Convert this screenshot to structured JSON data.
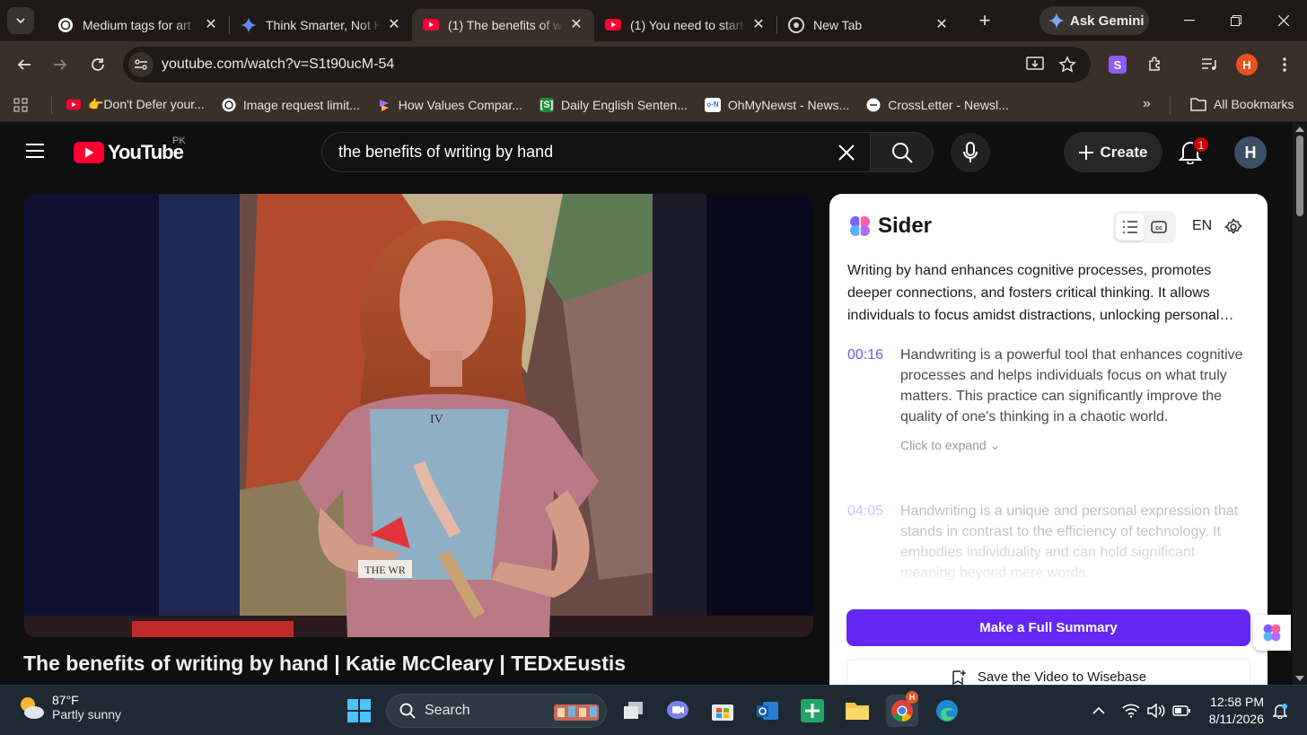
{
  "browser": {
    "tabs": [
      {
        "title": "Medium tags for art",
        "icon": "openai-icon",
        "active": false
      },
      {
        "title": "Think Smarter, Not H",
        "icon": "gemini-icon",
        "active": false
      },
      {
        "title": "(1) The benefits of w",
        "icon": "youtube-icon",
        "active": true
      },
      {
        "title": "(1) You need to start",
        "icon": "youtube-icon",
        "active": false
      },
      {
        "title": "New Tab",
        "icon": "chrome-icon",
        "active": false
      }
    ],
    "ask_gemini": "Ask Gemini",
    "url": "youtube.com/watch?v=S1t90ucM-54",
    "profile_initial": "H",
    "bookmarks": [
      {
        "label": "👉Don't Defer your...",
        "icon": "youtube-icon"
      },
      {
        "label": "Image request limit...",
        "icon": "openai-icon"
      },
      {
        "label": "How Values Compar...",
        "icon": "stack-icon"
      },
      {
        "label": "Daily English Senten...",
        "icon": "s-bracket-icon"
      },
      {
        "label": "OhMyNewst - News...",
        "icon": "ohmynews-icon"
      },
      {
        "label": "CrossLetter - Newsl...",
        "icon": "crossletter-icon"
      }
    ],
    "all_bookmarks": "All Bookmarks"
  },
  "youtube": {
    "logo_text": "YouTube",
    "region": "PK",
    "search_query": "the benefits of writing by hand",
    "create_label": "Create",
    "notification_count": "1",
    "avatar_initial": "H",
    "video_title": "The benefits of writing by hand | Katie McCleary | TEDxEustis"
  },
  "sider": {
    "name": "Sider",
    "language": "EN",
    "summary": "Writing by hand enhances cognitive processes, promotes deeper connections, and fosters critical thinking. It allows individuals to focus amidst distractions, unlocking personal…",
    "key_points": [
      {
        "time": "00:16",
        "text": "Handwriting is a powerful tool that enhances cognitive processes and helps individuals focus on what truly matters. This practice can significantly improve the quality of one's thinking in a chaotic world.",
        "expand": "Click to expand"
      },
      {
        "time": "04:05",
        "text": "Handwriting is a unique and personal expression that stands in contrast to the efficiency of technology. It embodies individuality and can hold significant meaning beyond mere words."
      }
    ],
    "full_summary_label": "Make a Full Summary",
    "save_label": "Save the Video to Wisebase",
    "accent": "#6227f5"
  },
  "taskbar": {
    "temperature": "87°F",
    "weather": "Partly sunny",
    "search_label": "Search",
    "time": "12:58 PM",
    "date": "8/11/2026"
  }
}
